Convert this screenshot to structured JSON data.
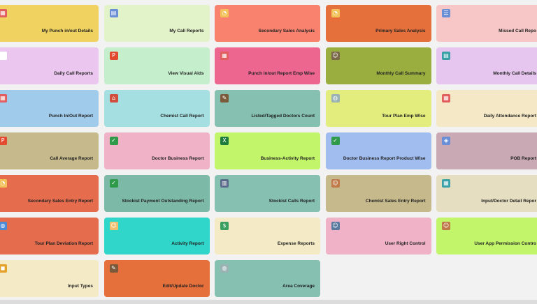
{
  "tiles": [
    {
      "label": "My Punch in/out Details",
      "color": "#efd25f",
      "icon": "calendar-icon",
      "glyph": "▦",
      "icon_color": "#e25d5d"
    },
    {
      "label": "My Call Reports",
      "color": "#e3f3c9",
      "icon": "document-icon",
      "glyph": "▤",
      "icon_color": "#6a8fd6"
    },
    {
      "label": "Secondary Sales Analysis",
      "color": "#f9826f",
      "icon": "chart-icon",
      "glyph": "◔",
      "icon_color": "#f3c15a"
    },
    {
      "label": "Primary Sales Analysis",
      "color": "#e5703b",
      "icon": "chart-icon",
      "glyph": "◔",
      "icon_color": "#f3c15a"
    },
    {
      "label": "Missed Call Repo",
      "color": "#f6c7c6",
      "icon": "list-icon",
      "glyph": "☰",
      "icon_color": "#6a8fd6"
    },
    {
      "label": "Daily Call Reports",
      "color": "#ebc6ef",
      "icon": "chat-icon",
      "glyph": "▭",
      "icon_color": "#ffffff"
    },
    {
      "label": "View Visual Aids",
      "color": "#c5efcc",
      "icon": "pdf-icon",
      "glyph": "P",
      "icon_color": "#e24a2f"
    },
    {
      "label": "Punch in/out Report Emp Wise",
      "color": "#ec6690",
      "icon": "calendar-icon",
      "glyph": "▦",
      "icon_color": "#e25d5d"
    },
    {
      "label": "Monthly Call Summary",
      "color": "#99ae3f",
      "icon": "user-icon",
      "glyph": "☺",
      "icon_color": "#7a6a4a"
    },
    {
      "label": "Monthly Call Details",
      "color": "#e6c6ef",
      "icon": "document-icon",
      "glyph": "▤",
      "icon_color": "#3aa0a8"
    },
    {
      "label": "Punch In/Out Report",
      "color": "#a1cbeb",
      "icon": "calendar-icon",
      "glyph": "▦",
      "icon_color": "#e25d5d"
    },
    {
      "label": "Chemist Call Report",
      "color": "#a6dfe1",
      "icon": "store-icon",
      "glyph": "⌂",
      "icon_color": "#d14d3b"
    },
    {
      "label": "Listed/Tagged Doctors Count",
      "color": "#85c0b0",
      "icon": "clipboard-icon",
      "glyph": "✎",
      "icon_color": "#7a5a3a"
    },
    {
      "label": "Tour Plan Emp Wise",
      "color": "#e2ed7e",
      "icon": "globe-icon",
      "glyph": "◍",
      "icon_color": "#9bb2b4"
    },
    {
      "label": "Daily Attendance Report",
      "color": "#f4e8c6",
      "icon": "calendar-icon",
      "glyph": "▦",
      "icon_color": "#e25d5d"
    },
    {
      "label": "Call Average Report",
      "color": "#c6b98b",
      "icon": "pdf-icon",
      "glyph": "P",
      "icon_color": "#e24a2f"
    },
    {
      "label": "Doctor Business Report",
      "color": "#f0b2c6",
      "icon": "check-icon",
      "glyph": "✓",
      "icon_color": "#2e9a4a"
    },
    {
      "label": "Business-Activity Report",
      "color": "#c3f56b",
      "icon": "spreadsheet-icon",
      "glyph": "X",
      "icon_color": "#1f7a3e"
    },
    {
      "label": "Doctor Business Report Product Wise",
      "color": "#a1bdf0",
      "icon": "check-icon",
      "glyph": "✓",
      "icon_color": "#2e9a4a"
    },
    {
      "label": "POB Report",
      "color": "#c8a9b4",
      "icon": "bag-icon",
      "glyph": "◈",
      "icon_color": "#6a8fd6"
    },
    {
      "label": "Secondary Sales Entry Report",
      "color": "#e56c4d",
      "icon": "chart-icon",
      "glyph": "◔",
      "icon_color": "#f3c15a"
    },
    {
      "label": "Stockist Payment Outstanding Report",
      "color": "#7db9a7",
      "icon": "check-icon",
      "glyph": "✓",
      "icon_color": "#2e9a4a"
    },
    {
      "label": "Stockist Calls Report",
      "color": "#85c0b0",
      "icon": "database-icon",
      "glyph": "▥",
      "icon_color": "#5a6a8a"
    },
    {
      "label": "Chemist Sales Entry Report",
      "color": "#c6b98b",
      "icon": "user-icon",
      "glyph": "☺",
      "icon_color": "#c07a4a"
    },
    {
      "label": "Input/Doctor Detail Repor",
      "color": "#e6dec0",
      "icon": "table-icon",
      "glyph": "▦",
      "icon_color": "#3aa0a8"
    },
    {
      "label": "Tour Plan Deviation Report",
      "color": "#e56c4d",
      "icon": "globe-icon",
      "glyph": "◍",
      "icon_color": "#4a8ad6"
    },
    {
      "label": "Activity Report",
      "color": "#2fd6c9",
      "icon": "doctor-icon",
      "glyph": "☺",
      "icon_color": "#f0c070"
    },
    {
      "label": "Expense Reports",
      "color": "#f4ebc6",
      "icon": "money-icon",
      "glyph": "$",
      "icon_color": "#3aa060"
    },
    {
      "label": "User Right Control",
      "color": "#f0b2c6",
      "icon": "user-icon",
      "glyph": "☺",
      "icon_color": "#5a7aa0"
    },
    {
      "label": "User App Permission Contro",
      "color": "#c3f56b",
      "icon": "lock-person-icon",
      "glyph": "☺",
      "icon_color": "#c07a4a"
    },
    {
      "label": "Input Types",
      "color": "#f4ebc6",
      "icon": "bag-icon",
      "glyph": "◼",
      "icon_color": "#e5a22a"
    },
    {
      "label": "Edit/Update Doctor",
      "color": "#e5703b",
      "icon": "clipboard-icon",
      "glyph": "✎",
      "icon_color": "#7a5a3a"
    },
    {
      "label": "Area Coverage",
      "color": "#85c0b0",
      "icon": "globe-icon",
      "glyph": "◍",
      "icon_color": "#9bb2b4"
    }
  ]
}
